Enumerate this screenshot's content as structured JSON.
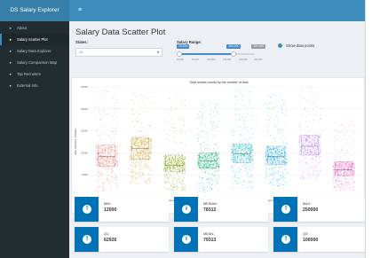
{
  "app": {
    "brand": "DS Salary Explorer",
    "hamburger_glyph": "≡"
  },
  "sidebar": {
    "items": [
      {
        "label": "About",
        "icon": "info-icon",
        "glyph": "▸"
      },
      {
        "label": "Salary Scatter Plot",
        "icon": "chart-icon",
        "glyph": "▸",
        "active": true
      },
      {
        "label": "Salary Data Explorer",
        "icon": "table-icon",
        "glyph": "▸"
      },
      {
        "label": "Salary Comparison Map",
        "icon": "map-icon",
        "glyph": "▸"
      },
      {
        "label": "Top Recruiters",
        "icon": "trophy-icon",
        "glyph": "▸"
      },
      {
        "label": "External Info",
        "icon": "link-icon",
        "glyph": "▸"
      }
    ]
  },
  "main": {
    "title": "Salary Data Scatter Plot",
    "states": {
      "label": "States:",
      "value": "All",
      "caret": "▾"
    },
    "salary_range": {
      "label": "Salary Range:",
      "min_tag": "15,000",
      "high_tag": "250,000",
      "max_tag": "300,000",
      "tick_labels": [
        "15,000",
        "60,000",
        "100,000",
        "150,000",
        "200,000",
        "250,000"
      ]
    },
    "show_points": "Show data points"
  },
  "chart_data": {
    "type": "scatter",
    "title": "Total review counts by the number of fans",
    "xlabel": "JOB_TITLE_SUBGROUP",
    "ylabel": "AVG_SALARY_RANGE",
    "ylim": [
      0,
      250000
    ],
    "ytick_labels": [
      "250000",
      "200000",
      "150000",
      "100000",
      "50000",
      "0"
    ],
    "categories": [
      "Business Analyst",
      "Data Ex.",
      "Data Analyst",
      "Data Scientist",
      "Data Engineer",
      "Management Consultant",
      "Software Engineer",
      "Teacher"
    ],
    "series_colors": [
      "#f8766d",
      "#cd9600",
      "#7cae00",
      "#00be67",
      "#00bfc4",
      "#00a9ff",
      "#c77cff",
      "#ff61cc"
    ],
    "medians": [
      92000,
      110000,
      72000,
      82000,
      98000,
      92000,
      115000,
      62000
    ],
    "q1": [
      70000,
      85000,
      58000,
      65000,
      78000,
      74000,
      95000,
      48000
    ],
    "q3": [
      118000,
      135000,
      95000,
      100000,
      120000,
      115000,
      140000,
      80000
    ],
    "ymin": [
      12000,
      30000,
      15000,
      12000,
      20000,
      25000,
      40000,
      15000
    ],
    "ymax": [
      248000,
      240000,
      230000,
      220000,
      245000,
      235000,
      250000,
      175000
    ]
  },
  "stats": [
    {
      "caption": "MIN:",
      "value": "12000",
      "glyph": "!"
    },
    {
      "caption": "MEDIAN:",
      "value": "78312",
      "glyph": "i"
    },
    {
      "caption": "MAX:",
      "value": "250000",
      "glyph": "!"
    },
    {
      "caption": "Q1:",
      "value": "62926",
      "glyph": "!"
    },
    {
      "caption": "MEAN:",
      "value": "79313",
      "glyph": "i"
    },
    {
      "caption": "Q3:",
      "value": "100000",
      "glyph": "!"
    }
  ]
}
